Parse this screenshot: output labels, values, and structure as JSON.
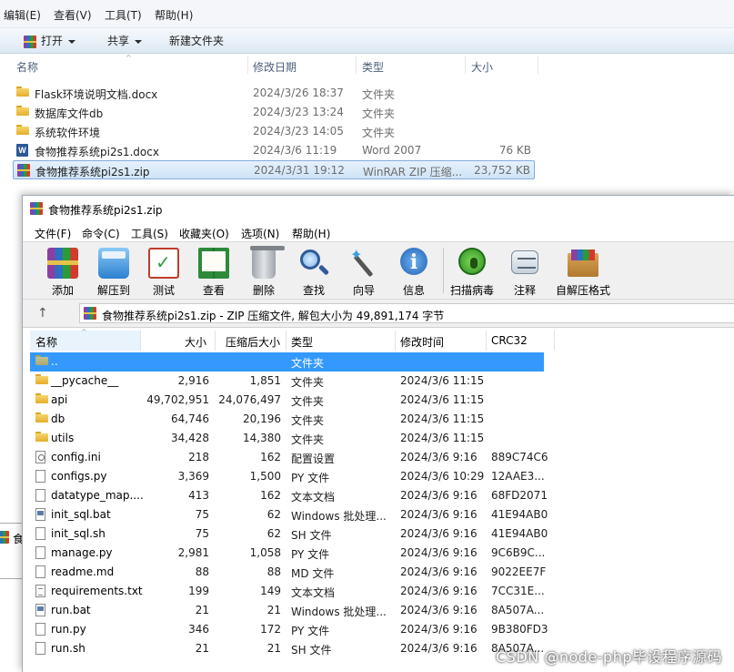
{
  "explorer": {
    "menu": [
      "编辑(E)",
      "查看(V)",
      "工具(T)",
      "帮助(H)"
    ],
    "toolbar": {
      "open_label": "打开",
      "share_label": "共享",
      "new_folder_label": "新建文件夹"
    },
    "columns": {
      "name": "名称",
      "modified": "修改日期",
      "type": "类型",
      "size": "大小"
    },
    "files": [
      {
        "name": "Flask环境说明文档.docx",
        "modified": "2024/3/26 18:37",
        "type": "文件夹",
        "size": "",
        "icon": "folder-icon"
      },
      {
        "name": "数据库文件db",
        "modified": "2024/3/23 13:24",
        "type": "文件夹",
        "size": "",
        "icon": "folder-icon"
      },
      {
        "name": "系统软件环境",
        "modified": "2024/3/23 14:05",
        "type": "文件夹",
        "size": "",
        "icon": "folder-icon"
      },
      {
        "name": "食物推荐系统pi2s1.docx",
        "modified": "2024/3/6 11:19",
        "type": "Word 2007",
        "size": "76 KB",
        "icon": "word-doc-icon"
      },
      {
        "name": "食物推荐系统pi2s1.zip",
        "modified": "2024/3/31 19:12",
        "type": "WinRAR ZIP 压缩...",
        "size": "23,752 KB",
        "icon": "winrar-archive-icon",
        "selected": true
      }
    ],
    "peek_text": "食"
  },
  "winrar": {
    "title": "食物推荐系统pi2s1.zip",
    "menu": [
      "文件(F)",
      "命令(C)",
      "工具(S)",
      "收藏夹(O)",
      "选项(N)",
      "帮助(H)"
    ],
    "toolbar": [
      {
        "label": "添加",
        "icon": "add-icon"
      },
      {
        "label": "解压到",
        "icon": "extract-icon"
      },
      {
        "label": "测试",
        "icon": "test-icon"
      },
      {
        "label": "查看",
        "icon": "view-icon"
      },
      {
        "label": "删除",
        "icon": "delete-icon"
      },
      {
        "label": "查找",
        "icon": "find-icon"
      },
      {
        "label": "向导",
        "icon": "wizard-icon"
      },
      {
        "label": "信息",
        "icon": "info-icon"
      },
      {
        "label": "扫描病毒",
        "icon": "virus-scan-icon"
      },
      {
        "label": "注释",
        "icon": "comment-icon"
      },
      {
        "label": "自解压格式",
        "icon": "sfx-icon"
      }
    ],
    "address": "食物推荐系统pi2s1.zip - ZIP 压缩文件, 解包大小为 49,891,174 字节",
    "columns": {
      "name": "名称",
      "size": "大小",
      "packed": "压缩后大小",
      "type": "类型",
      "modified": "修改时间",
      "crc": "CRC32"
    },
    "rows": [
      {
        "name": "..",
        "size": "",
        "packed": "",
        "type": "文件夹",
        "modified": "",
        "crc": "",
        "icon": "parent-folder-icon",
        "selected": true
      },
      {
        "name": "__pycache__",
        "size": "2,916",
        "packed": "1,851",
        "type": "文件夹",
        "modified": "2024/3/6 11:15",
        "crc": "",
        "icon": "folder-icon"
      },
      {
        "name": "api",
        "size": "49,702,951",
        "packed": "24,076,497",
        "type": "文件夹",
        "modified": "2024/3/6 11:15",
        "crc": "",
        "icon": "folder-icon"
      },
      {
        "name": "db",
        "size": "64,746",
        "packed": "20,196",
        "type": "文件夹",
        "modified": "2024/3/6 11:15",
        "crc": "",
        "icon": "folder-icon"
      },
      {
        "name": "utils",
        "size": "34,428",
        "packed": "14,380",
        "type": "文件夹",
        "modified": "2024/3/6 11:15",
        "crc": "",
        "icon": "folder-icon"
      },
      {
        "name": "config.ini",
        "size": "218",
        "packed": "162",
        "type": "配置设置",
        "modified": "2024/3/6 9:16",
        "crc": "889C74C6",
        "icon": "config-file-icon"
      },
      {
        "name": "configs.py",
        "size": "3,369",
        "packed": "1,500",
        "type": "PY 文件",
        "modified": "2024/3/6 10:29",
        "crc": "12AAE3...",
        "icon": "file-icon"
      },
      {
        "name": "datatype_map....",
        "size": "413",
        "packed": "162",
        "type": "文本文档",
        "modified": "2024/3/6 9:16",
        "crc": "68FD2071",
        "icon": "file-icon"
      },
      {
        "name": "init_sql.bat",
        "size": "75",
        "packed": "62",
        "type": "Windows 批处理...",
        "modified": "2024/3/6 9:16",
        "crc": "41E94AB0",
        "icon": "batch-file-icon"
      },
      {
        "name": "init_sql.sh",
        "size": "75",
        "packed": "62",
        "type": "SH 文件",
        "modified": "2024/3/6 9:16",
        "crc": "41E94AB0",
        "icon": "file-icon"
      },
      {
        "name": "manage.py",
        "size": "2,981",
        "packed": "1,058",
        "type": "PY 文件",
        "modified": "2024/3/6 9:16",
        "crc": "9C6B9C...",
        "icon": "file-icon"
      },
      {
        "name": "readme.md",
        "size": "88",
        "packed": "88",
        "type": "MD 文件",
        "modified": "2024/3/6 9:16",
        "crc": "9022EE7F",
        "icon": "file-icon"
      },
      {
        "name": "requirements.txt",
        "size": "199",
        "packed": "149",
        "type": "文本文档",
        "modified": "2024/3/6 9:16",
        "crc": "7CC31E...",
        "icon": "text-file-icon"
      },
      {
        "name": "run.bat",
        "size": "21",
        "packed": "21",
        "type": "Windows 批处理...",
        "modified": "2024/3/6 9:16",
        "crc": "8A507A...",
        "icon": "batch-file-icon"
      },
      {
        "name": "run.py",
        "size": "346",
        "packed": "172",
        "type": "PY 文件",
        "modified": "2024/3/6 9:16",
        "crc": "9B380FD3",
        "icon": "file-icon"
      },
      {
        "name": "run.sh",
        "size": "21",
        "packed": "21",
        "type": "SH 文件",
        "modified": "2024/3/6 9:16",
        "crc": "8A507A...",
        "icon": "file-icon"
      }
    ]
  },
  "watermark": "CSDN @node-php毕设程序源码"
}
